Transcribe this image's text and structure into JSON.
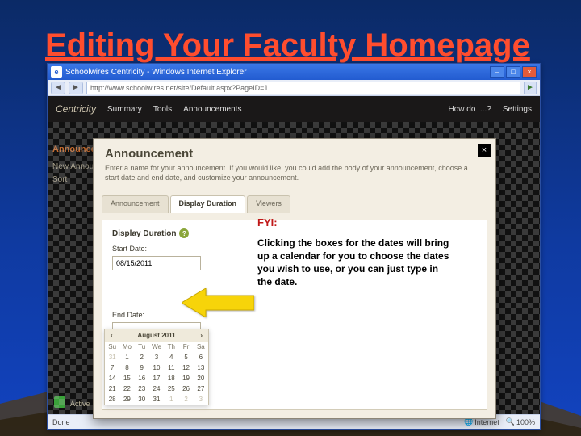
{
  "slide": {
    "title": "Editing Your Faculty Homepage"
  },
  "browser": {
    "title": "Schoolwires Centricity - Windows Internet Explorer",
    "address": "http://www.schoolwires.net/site/Default.aspx?PageID=1",
    "status_left": "Done",
    "status_zoom": "100%",
    "status_mode": "Internet"
  },
  "app": {
    "brand": "Centricity",
    "top_items": [
      "Summary",
      "Tools",
      "Announcements"
    ],
    "top_right": [
      "How do I...?",
      "Settings"
    ],
    "side_head": "Announcements",
    "side_items": [
      "New Announcement",
      "Sort"
    ],
    "status_text": "Active"
  },
  "modal": {
    "title": "Announcement",
    "subtitle": "Enter a name for your announcement. If you would like, you could add the body of your announcement, choose a start date and end date, and customize your announcement.",
    "tabs": [
      "Announcement",
      "Display Duration",
      "Viewers"
    ],
    "active_tab": 1,
    "panel_label": "Display Duration",
    "start_label": "Start Date:",
    "start_value": "08/15/2011",
    "end_label": "End Date:",
    "end_value": "",
    "calendar": {
      "month_label": "August 2011",
      "dow": [
        "Su",
        "Mo",
        "Tu",
        "We",
        "Th",
        "Fr",
        "Sa"
      ],
      "leading_muted": [
        31
      ],
      "days": [
        1,
        2,
        3,
        4,
        5,
        6,
        7,
        8,
        9,
        10,
        11,
        12,
        13,
        14,
        15,
        16,
        17,
        18,
        19,
        20,
        21,
        22,
        23,
        24,
        25,
        26,
        27,
        28,
        29,
        30,
        31
      ],
      "trailing_muted": [
        1,
        2,
        3
      ]
    }
  },
  "fyi": {
    "head": "FYI:",
    "body": "Clicking the boxes for the dates will bring up a calendar for you to choose the dates you wish to use, or you can just type in the date."
  }
}
